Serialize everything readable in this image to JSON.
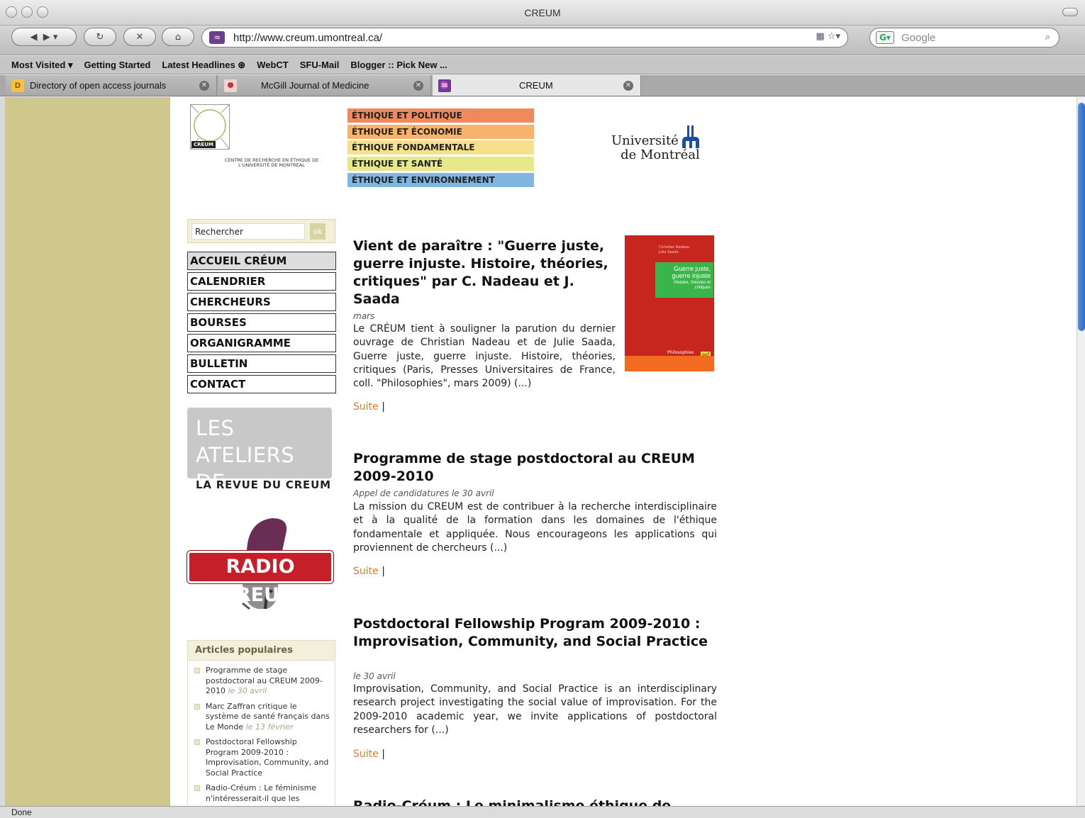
{
  "window": {
    "title": "CREUM"
  },
  "toolbar": {
    "url": "http://www.creum.umontreal.ca/",
    "search_placeholder": "Google"
  },
  "bookmarks": [
    "Most Visited ▾",
    "Getting Started",
    "Latest Headlines ⊛",
    "WebCT",
    "SFU-Mail",
    "Blogger :: Pick New ..."
  ],
  "tabs": [
    {
      "icon": "D",
      "label": "Directory of open access journals"
    },
    {
      "icon": "☸",
      "label": "McGill Journal of Medicine"
    },
    {
      "icon": "♒",
      "label": "CREUM"
    }
  ],
  "status": "Done",
  "header": {
    "logo_text": "CREUM",
    "logo_caption": "CENTRE DE RECHERCHE EN ÉTHIQUE DE L'UNIVERSITÉ DE MONTRÉAL",
    "themes": [
      {
        "label": "ÉTHIQUE ET POLITIQUE",
        "color": "#f08a5d"
      },
      {
        "label": "ÉTHIQUE ET ÉCONOMIE",
        "color": "#f7b26b"
      },
      {
        "label": "ÉTHIQUE FONDAMENTALE",
        "color": "#f6e08c"
      },
      {
        "label": "ÉTHIQUE ET SANTÉ",
        "color": "#e6e88a"
      },
      {
        "label": "ÉTHIQUE ET ENVIRONNEMENT",
        "color": "#7fb7e0"
      }
    ],
    "university_line1": "Université",
    "university_line2": "de Montréal"
  },
  "sidebar": {
    "search_value": "Rechercher",
    "search_button": "ok",
    "menu": [
      "ACCUEIL CRÉUM",
      "CALENDRIER",
      "CHERCHEURS",
      "BOURSES",
      "ORGANIGRAMME",
      "BULLETIN",
      "CONTACT"
    ],
    "ateliers_line1": "LES ATELIERS",
    "ateliers_line2": "DE L'ÉTHIQUE",
    "ateliers_sub": "LA REVUE DU CREUM",
    "radio_label": "RADIO CREUM",
    "popular_title": "Articles populaires",
    "popular": [
      {
        "text": "Programme de stage postdoctoral au CREUM 2009-2010",
        "date": "le 30 avril"
      },
      {
        "text": "Marc Zaffran critique le système de santé français dans Le Monde",
        "date": "le 13 février"
      },
      {
        "text": "Postdoctoral Fellowship Program 2009-2010 : Improvisation, Community, and Social Practice",
        "date": ""
      },
      {
        "text": "Radio-Créum : Le féminisme n'intéresserait-il que les",
        "date": ""
      }
    ]
  },
  "articles": [
    {
      "title": "Vient de paraître : \"Guerre juste, guerre injuste. Histoire, théories, critiques\" par C. Nadeau et J. Saada",
      "meta": "mars",
      "body": "Le CRÉUM tient à souligner la parution du dernier ouvrage de Christian Nadeau et de Julie Saada, Guerre juste, guerre injuste. Histoire, théories, critiques (Paris, Presses Universitaires de France, coll. \"Philosophies\", mars 2009) (...)",
      "more": "Suite"
    },
    {
      "title": "Programme de stage postdoctoral au CREUM 2009-2010",
      "meta": "Appel de candidatures le 30 avril",
      "body": "La mission du CREUM est de contribuer à la recherche interdisciplinaire et à la qualité de la formation dans les domaines de l'éthique fondamentale et appliquée. Nous encourageons les applications qui proviennent de chercheurs (...)",
      "more": "Suite"
    },
    {
      "title": "Postdoctoral Fellowship Program 2009-2010 : Improvisation, Community, and Social Practice",
      "meta": "le 30 avril",
      "body": "Improvisation, Community, and Social Practice is an interdisciplinary research project investigating the social value of improvisation. For the 2009-2010 academic year, we invite applications of postdoctoral researchers for (...)",
      "more": "Suite"
    },
    {
      "title": "Radio-Créum : Le minimalisme éthique de",
      "meta": "",
      "body": "",
      "more": ""
    }
  ],
  "book": {
    "authors": "Christian Nadeau\nJulie Saada",
    "title": "Guerre juste, guerre injuste",
    "subtitle": "Histoire, théories et critiques",
    "series": "Philosophies",
    "publisher": "puf"
  },
  "colors": {
    "sidebar_band": "#cfc88d",
    "link": "#e07d2a",
    "radio_red": "#c61f2a"
  }
}
